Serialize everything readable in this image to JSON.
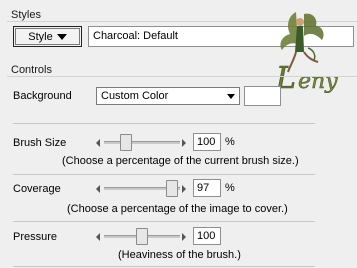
{
  "styles_group": {
    "title": "Styles",
    "style_button_label": "Style",
    "preset_value": "Charcoal: Default"
  },
  "controls_group": {
    "title": "Controls",
    "background": {
      "label": "Background",
      "selected": "Custom Color",
      "swatch_color": "#ffffff"
    },
    "brush_size": {
      "label": "Brush Size",
      "value": "100",
      "unit": "%",
      "hint": "(Choose a percentage of the current brush size.)",
      "slider_fraction": 0.25
    },
    "coverage": {
      "label": "Coverage",
      "value": "97",
      "unit": "%",
      "hint": "(Choose a percentage of the image to cover.)",
      "slider_fraction": 0.97
    },
    "pressure": {
      "label": "Pressure",
      "value": "100",
      "hint": "(Heaviness of the brush.)",
      "slider_fraction": 0.5
    }
  },
  "watermark": {
    "text": "Leny"
  }
}
